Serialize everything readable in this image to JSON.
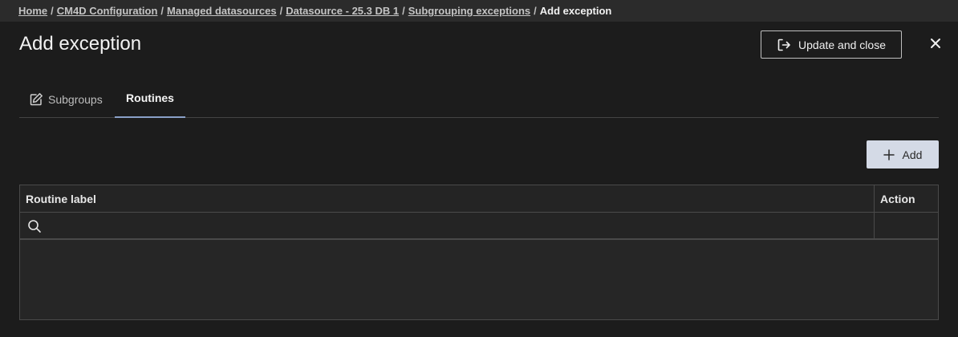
{
  "breadcrumb": {
    "items": [
      {
        "label": "Home"
      },
      {
        "label": "CM4D Configuration"
      },
      {
        "label": "Managed datasources"
      },
      {
        "label": "Datasource - 25.3 DB 1"
      },
      {
        "label": "Subgrouping exceptions"
      }
    ],
    "separator": "/",
    "current": "Add exception"
  },
  "header": {
    "title": "Add exception",
    "update_close_label": "Update and close",
    "update_close_icon": "sign-out-icon",
    "close_icon": "close-icon"
  },
  "tabs": [
    {
      "label": "Subgroups",
      "icon": "edit-icon",
      "active": false
    },
    {
      "label": "Routines",
      "active": true
    }
  ],
  "toolbar": {
    "add_label": "Add",
    "add_icon": "plus-icon"
  },
  "grid": {
    "columns": [
      {
        "label": "Routine label"
      },
      {
        "label": "Action"
      }
    ],
    "filter": {
      "value": "",
      "placeholder": ""
    },
    "rows": []
  },
  "colors": {
    "background": "#1c1c1c",
    "breadcrumb_bar": "#2b2b2b",
    "add_button": "#d4dae6",
    "active_tab_underline": "#8aa0c8"
  }
}
